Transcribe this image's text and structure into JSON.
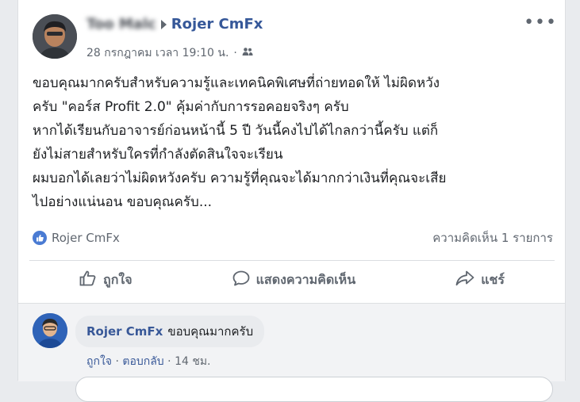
{
  "post": {
    "author_obscured": "Too Malc",
    "target_page": "Rojer CmFx",
    "timestamp": "28 กรกฎาคม เวลา 19:10 น.",
    "audience_icon": "friends-icon",
    "more_icon": "•••",
    "body_lines": [
      "ขอบคุณมากครับสำหรับความรู้และเทคนิคพิเศษที่ถ่ายทอดให้ ไม่ผิดหวัง",
      "ครับ \"คอร์ส Profit 2.0\" คุ้มค่ากับการรอคอยจริงๆ ครับ",
      "หากได้เรียนกับอาจารย์ก่อนหน้านี้ 5 ปี วันนี้คงไปได้ไกลกว่านี้ครับ แต่ก็",
      "ยังไม่สายสำหรับใครที่กำลังตัดสินใจจะเรียน",
      "ผมบอกได้เลยว่าไม่ผิดหวังครับ ความรู้ที่คุณจะได้มากกว่าเงินที่คุณจะเสีย",
      "ไปอย่างแน่นอน ขอบคุณครับ..."
    ]
  },
  "stats": {
    "liker": "Rojer CmFx",
    "comment_count": "ความคิดเห็น 1 รายการ"
  },
  "actions": {
    "like": "ถูกใจ",
    "comment": "แสดงความคิดเห็น",
    "share": "แชร์"
  },
  "comment": {
    "author": "Rojer CmFx",
    "text": "ขอบคุณมากครับ",
    "like": "ถูกใจ",
    "reply": "ตอบกลับ",
    "age": "14 ชม."
  },
  "colors": {
    "link": "#365899",
    "meta": "#606770",
    "like_badge": "#4a7bd3"
  }
}
